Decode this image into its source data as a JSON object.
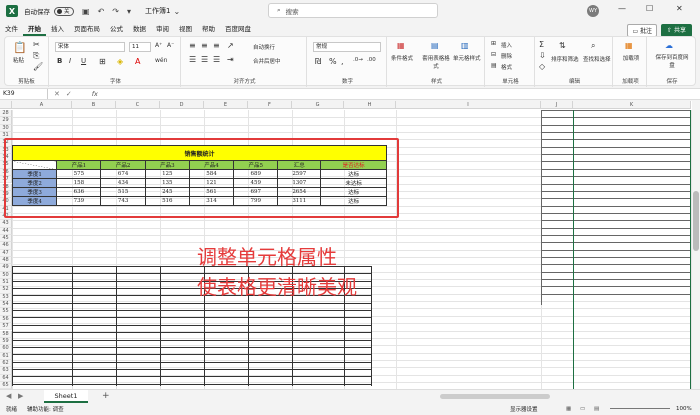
{
  "titlebar": {
    "logo": "X",
    "autosave_label": "自动保存",
    "autosave_state": "关",
    "doc_title": "工作簿1",
    "search_placeholder": "搜索",
    "avatar": "WY"
  },
  "menu": {
    "items": [
      "文件",
      "开始",
      "插入",
      "页面布局",
      "公式",
      "数据",
      "审阅",
      "视图",
      "帮助",
      "百度网盘"
    ],
    "active_index": 1,
    "annotate_label": "批注",
    "share_label": "共享"
  },
  "ribbon": {
    "clipboard": {
      "paste": "粘贴",
      "label": "剪贴板"
    },
    "font": {
      "font_name": "宋体",
      "font_size": "11",
      "label": "字体",
      "bold": "B",
      "italic": "I",
      "underline": "U"
    },
    "alignment": {
      "wrap": "自动换行",
      "merge": "合并后居中",
      "label": "对齐方式"
    },
    "number": {
      "format": "常规",
      "label": "数字",
      "percent": "%",
      "comma": ","
    },
    "styles": {
      "conditional": "条件格式",
      "table": "套用表格格式",
      "cell": "单元格样式",
      "label": "样式"
    },
    "cells": {
      "insert": "插入",
      "delete": "删除",
      "format": "格式",
      "label": "单元格"
    },
    "editing": {
      "sort": "排序和筛选",
      "find": "查找和选择",
      "label": "编辑"
    },
    "addins": {
      "label_btn": "加载项",
      "label": "加载项"
    },
    "save": {
      "btn": "保存到百度网盘",
      "label": "保存"
    }
  },
  "formula_bar": {
    "name_box": "K39",
    "fx": "fx"
  },
  "columns": [
    "A",
    "B",
    "C",
    "D",
    "E",
    "F",
    "G",
    "H",
    "I",
    "J",
    "K"
  ],
  "rows": [
    "28",
    "29",
    "30",
    "31",
    "32",
    "33",
    "34",
    "35",
    "36",
    "37",
    "38",
    "39",
    "40",
    "41",
    "42",
    "43",
    "44",
    "45",
    "46",
    "47",
    "48",
    "49",
    "50",
    "51",
    "52",
    "53",
    "54",
    "55",
    "56",
    "57",
    "58",
    "59",
    "60",
    "61",
    "62",
    "63",
    "64",
    "65",
    "66",
    "67"
  ],
  "table": {
    "title": "销售额统计",
    "headers": [
      "产品1",
      "产品2",
      "产品3",
      "产品4",
      "产品5",
      "汇总",
      "是否达标"
    ],
    "rows": [
      {
        "label": "季度1",
        "values": [
          "575",
          "674",
          "125",
          "584",
          "689",
          "2597",
          "达标"
        ]
      },
      {
        "label": "季度2",
        "values": [
          "158",
          "434",
          "135",
          "121",
          "459",
          "1307",
          "未达标"
        ]
      },
      {
        "label": "季度3",
        "values": [
          "636",
          "515",
          "245",
          "561",
          "697",
          "2654",
          "达标"
        ]
      },
      {
        "label": "季度4",
        "values": [
          "739",
          "743",
          "516",
          "314",
          "799",
          "3111",
          "达标"
        ]
      }
    ]
  },
  "annotation": {
    "line1": "调整单元格属性",
    "line2": "使表格更清晰美观"
  },
  "sheet_tabs": {
    "active": "Sheet1",
    "add": "+"
  },
  "status": {
    "ready": "就绪",
    "accessibility": "辅助功能: 调查",
    "display": "显示器设置",
    "zoom": "100%"
  },
  "colors": {
    "excel_green": "#1d6f42",
    "title_yellow": "#ffff00",
    "header_green": "#92d050",
    "quarter_blue": "#8eaadb",
    "red": "#e23a3a"
  }
}
